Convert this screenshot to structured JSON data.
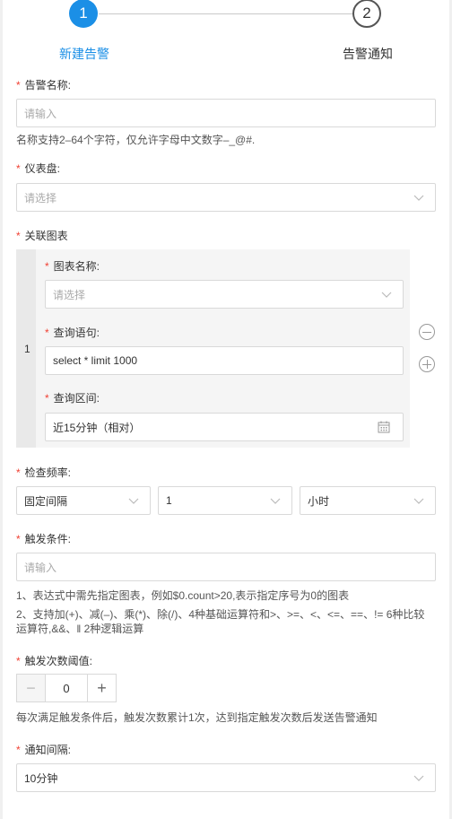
{
  "steps": {
    "step1_number": "1",
    "step1_label": "新建告警",
    "step2_number": "2",
    "step2_label": "告警通知"
  },
  "alert_name": {
    "label": "告警名称:",
    "placeholder": "请输入",
    "hint": "名称支持2–64个字符，仅允许字母中文数字–_@#."
  },
  "dashboard": {
    "label": "仪表盘:",
    "placeholder": "请选择"
  },
  "related_chart": {
    "label": "关联图表",
    "index": "1",
    "chart_name_label": "图表名称:",
    "chart_name_placeholder": "请选择",
    "query_label": "查询语句:",
    "query_value": "select * limit 1000",
    "range_label": "查询区间:",
    "range_value": "近15分钟（相对）"
  },
  "check_frequency": {
    "label": "检查频率:",
    "mode": "固定间隔",
    "value": "1",
    "unit": "小时"
  },
  "trigger_condition": {
    "label": "触发条件:",
    "placeholder": "请输入",
    "hint1": "1、表达式中需先指定图表，例如$0.count>20,表示指定序号为0的图表",
    "hint2a": "2、支持加(+)、减(–)、乘(*)、除(/)、4种基础运算符和>、>=、<、<=、==、!= 6种比较",
    "hint2b": "运算符,&&、‖ 2种逻辑运算"
  },
  "trigger_threshold": {
    "label": "触发次数阈值:",
    "minus": "−",
    "value": "0",
    "plus": "+",
    "hint": "每次满足触发条件后，触发次数累计1次，达到指定触发次数后发送告警通知"
  },
  "notify_interval": {
    "label": "通知间隔:",
    "value": "10分钟"
  },
  "colors": {
    "accent": "#1b8fe6",
    "required": "#f04134"
  },
  "icons": {
    "chevron": "chevron-down-icon",
    "calendar": "calendar-icon",
    "remove": "minus-circle-icon",
    "add": "plus-circle-icon"
  }
}
